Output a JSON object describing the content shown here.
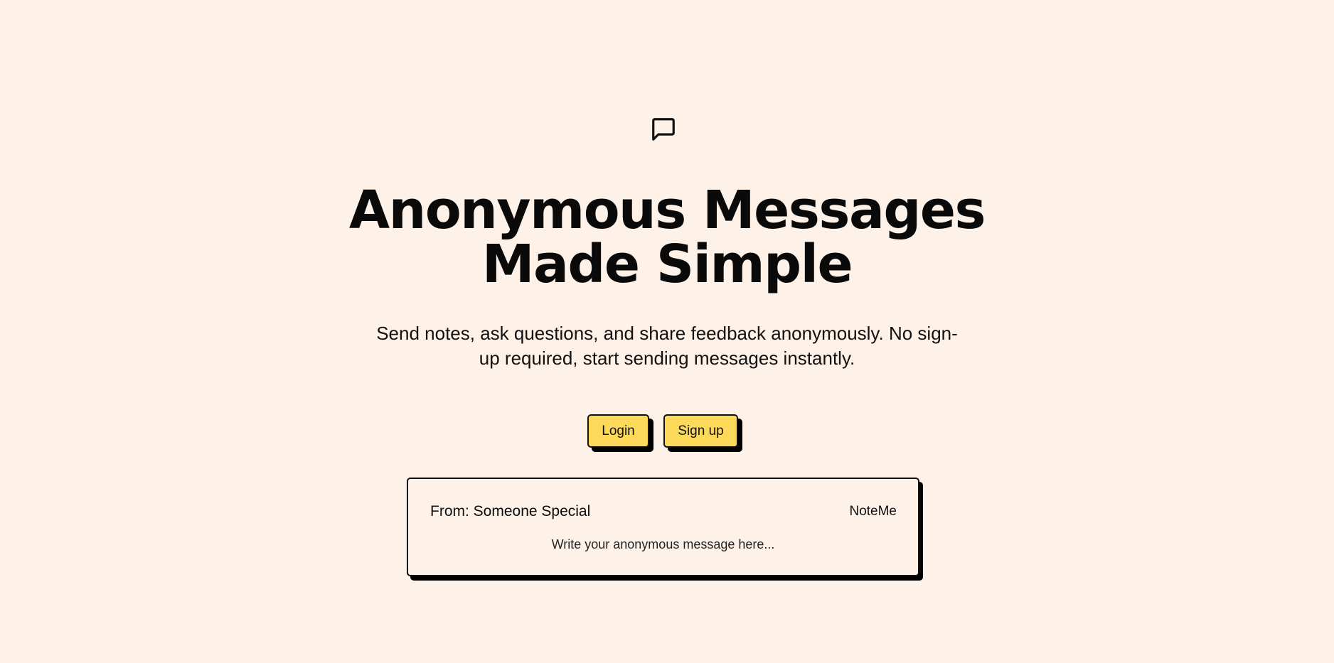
{
  "hero": {
    "icon": "message-square-icon",
    "headline_line1": "Anonymous Messages",
    "headline_line2": "Made Simple",
    "subtitle": "Send notes, ask questions, and share feedback anonymously. No sign-up required, start sending messages instantly."
  },
  "actions": {
    "login_label": "Login",
    "signup_label": "Sign up",
    "accent_color": "#fdd95a"
  },
  "card": {
    "from_label": "From:",
    "from_name": "Someone Special",
    "brand": "NoteMe",
    "message_placeholder": "Write your anonymous message here..."
  },
  "colors": {
    "background": "#fef1e8",
    "text": "#0a0a0a",
    "shadow": "#000000"
  }
}
